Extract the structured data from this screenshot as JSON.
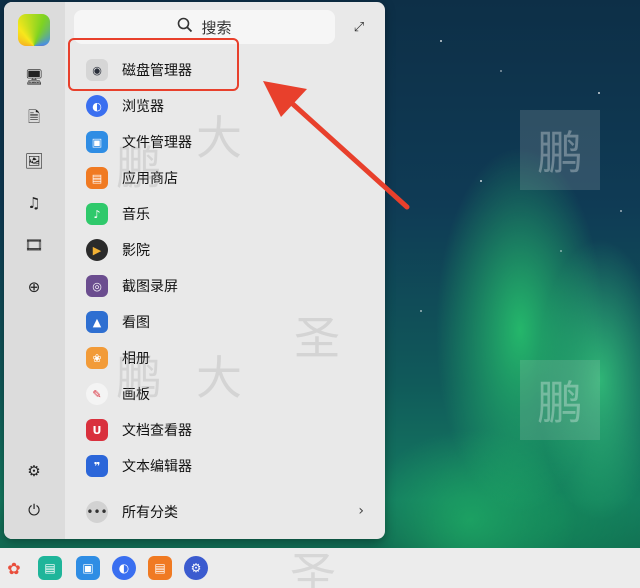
{
  "search": {
    "label": "搜索"
  },
  "apps": [
    {
      "label": "磁盘管理器",
      "icon": "disk-manager-icon",
      "color": "#2a2f3a"
    },
    {
      "label": "浏览器",
      "icon": "browser-icon",
      "color": "#3a6ff0"
    },
    {
      "label": "文件管理器",
      "icon": "file-manager-icon",
      "color": "#2f8de4"
    },
    {
      "label": "应用商店",
      "icon": "app-store-icon",
      "color": "#f07a22"
    },
    {
      "label": "音乐",
      "icon": "music-icon",
      "color": "#2fc96b"
    },
    {
      "label": "影院",
      "icon": "video-icon",
      "color": "#2b2b2b"
    },
    {
      "label": "截图录屏",
      "icon": "screenshot-icon",
      "color": "#6b4d8f"
    },
    {
      "label": "看图",
      "icon": "image-viewer-icon",
      "color": "#2e6fd1"
    },
    {
      "label": "相册",
      "icon": "album-icon",
      "color": "#f29b38"
    },
    {
      "label": "画板",
      "icon": "drawing-board-icon",
      "color": "#e6e6e6"
    },
    {
      "label": "文档查看器",
      "icon": "document-viewer-icon",
      "color": "#d9303d"
    },
    {
      "label": "文本编辑器",
      "icon": "text-editor-icon",
      "color": "#2b66d9"
    }
  ],
  "all_categories": {
    "label": "所有分类"
  },
  "watermark": {
    "chars": [
      "鹏",
      "大",
      "圣"
    ]
  },
  "colors": {
    "highlight": "#e8402c",
    "arrow": "#e8402c"
  }
}
